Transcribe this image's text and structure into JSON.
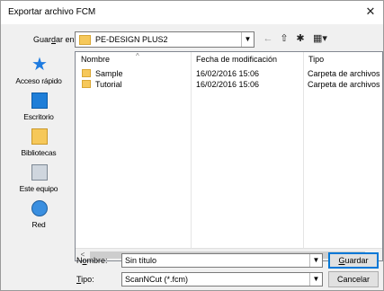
{
  "window": {
    "title": "Exportar archivo FCM",
    "close_glyph": "✕"
  },
  "lookin": {
    "label_pre": "Guar",
    "label_u": "d",
    "label_post": "ar en:",
    "value": "PE-DESIGN PLUS2"
  },
  "toolbar": {
    "back_icon": "back-arrow-icon",
    "up_icon": "up-folder-icon",
    "new_folder_icon": "new-folder-icon",
    "views_icon": "views-menu-icon"
  },
  "places": [
    {
      "label": "Acceso rápido",
      "icon": "star-icon"
    },
    {
      "label": "Escritorio",
      "icon": "desktop-icon"
    },
    {
      "label": "Bibliotecas",
      "icon": "libraries-icon"
    },
    {
      "label": "Este equipo",
      "icon": "computer-icon"
    },
    {
      "label": "Red",
      "icon": "network-icon"
    }
  ],
  "list": {
    "columns": [
      "Nombre",
      "Fecha de modificación",
      "Tipo"
    ],
    "rows": [
      {
        "name": "Sample",
        "date": "16/02/2016 15:06",
        "type": "Carpeta de archivos"
      },
      {
        "name": "Tutorial",
        "date": "16/02/2016 15:06",
        "type": "Carpeta de archivos"
      }
    ]
  },
  "filename": {
    "label_pre": "N",
    "label_u": "o",
    "label_post": "mbre:",
    "value": "Sin título"
  },
  "filetype": {
    "label_u": "T",
    "label_post": "ipo:",
    "value": "ScanNCut (*.fcm)"
  },
  "buttons": {
    "save_u": "G",
    "save_rest": "uardar",
    "cancel": "Cancelar"
  },
  "colors": {
    "folder": "#f6c85a",
    "accent": "#0078d7"
  }
}
